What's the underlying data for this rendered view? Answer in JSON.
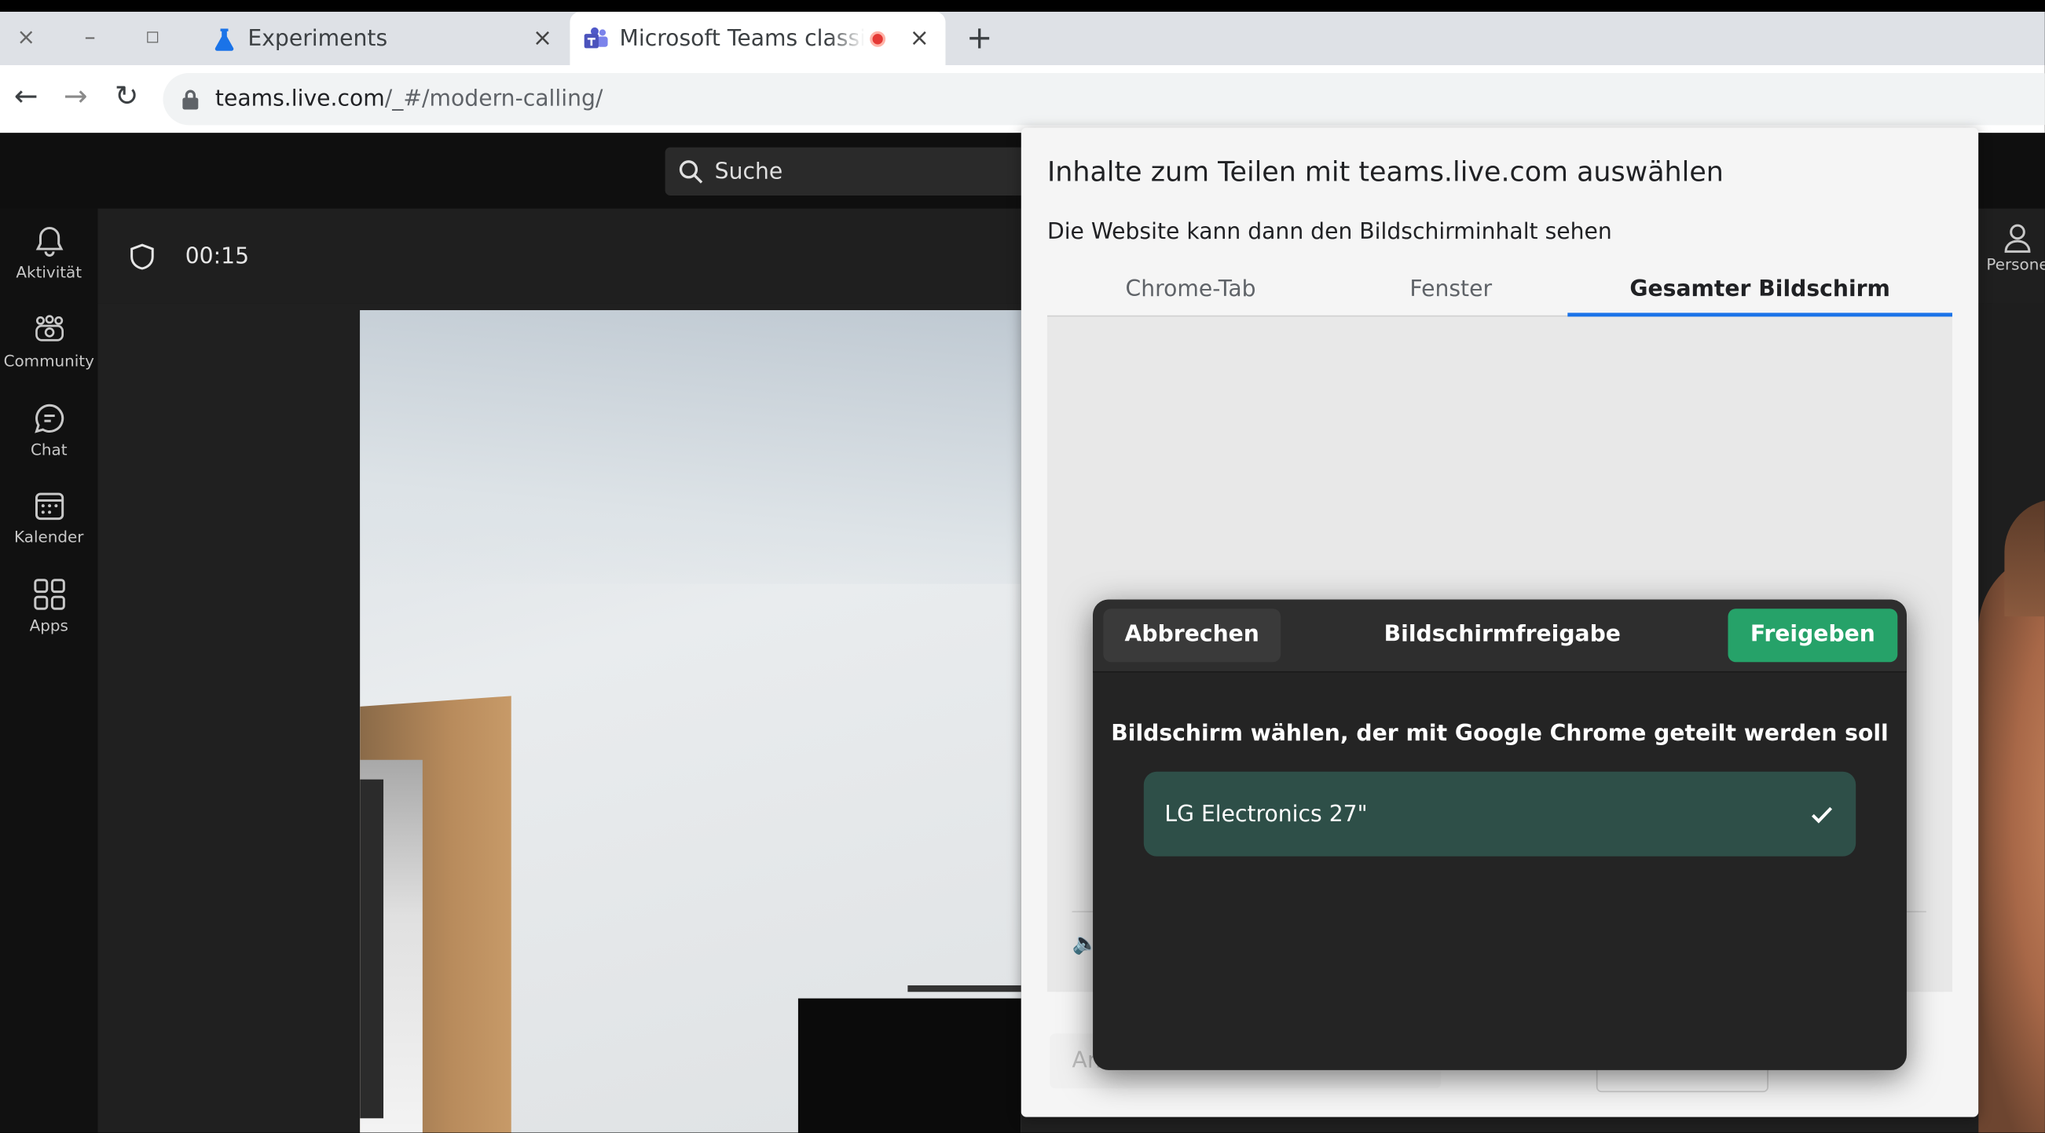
{
  "browser": {
    "window_controls": {
      "close": "×",
      "minimize": "–",
      "maximize": "◻"
    },
    "tabs": [
      {
        "title": "Experiments",
        "icon": "flask-icon",
        "active": false,
        "close": "×"
      },
      {
        "title": "Microsoft Teams classic",
        "icon": "teams-icon",
        "active": true,
        "recording": true,
        "close": "×"
      }
    ],
    "new_tab": "+",
    "nav": {
      "back": "←",
      "forward": "→",
      "reload": "↻"
    },
    "url_host": "teams.live.com",
    "url_path": "/_#/modern-calling/"
  },
  "teams": {
    "search_placeholder": "Suche",
    "rail": [
      {
        "label": "Aktivität",
        "icon": "bell-icon"
      },
      {
        "label": "Community",
        "icon": "community-icon"
      },
      {
        "label": "Chat",
        "icon": "chat-icon"
      },
      {
        "label": "Kalender",
        "icon": "calendar-icon"
      },
      {
        "label": "Apps",
        "icon": "apps-icon"
      }
    ],
    "call_timer": "00:15",
    "people_label": "Persone"
  },
  "share_dialog": {
    "title": "Inhalte zum Teilen mit teams.live.com auswählen",
    "subtitle": "Die Website kann dann den Bildschirminhalt sehen",
    "tabs": [
      {
        "label": "Chrome-Tab",
        "selected": false
      },
      {
        "label": "Fenster",
        "selected": false
      },
      {
        "label": "Gesamter Bildschirm",
        "selected": true
      }
    ],
    "partial_label": "An",
    "accent_color": "#1a73e8"
  },
  "portal": {
    "cancel_label": "Abbrechen",
    "title": "Bildschirmfreigabe",
    "share_label": "Freigeben",
    "heading": "Bildschirm wählen, der mit Google Chrome geteilt werden soll",
    "monitors": [
      {
        "label": "LG Electronics 27\"",
        "selected": true
      }
    ],
    "accent_color": "#26a269"
  }
}
